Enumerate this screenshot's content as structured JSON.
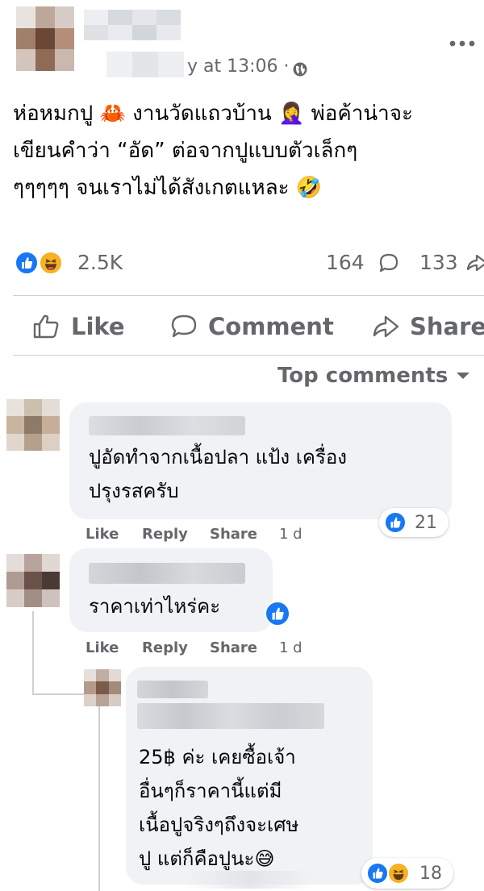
{
  "post": {
    "timestamp": "y at 13:06 ·",
    "more_icon": "more-dots-icon",
    "body_lines": [
      "ห่อหมกปู 🦀 งานวัดแถวบ้าน 🤦‍♀️ พ่อค้าน่าจะ",
      "เขียนคำว่า “อัด” ต่อจากปูแบบตัวเล็กๆ",
      "ๆๆๆๆๆ จนเราไม่ได้สังเกตแหละ 🤣"
    ]
  },
  "stats": {
    "reactions_count": "2.5K",
    "comments_count": "164",
    "shares_count": "133"
  },
  "actions": {
    "like": "Like",
    "comment": "Comment",
    "share": "Share"
  },
  "sort": {
    "label": "Top comments"
  },
  "comments": [
    {
      "text_lines": [
        "ปูอัดทำจากเนื้อปลา แป้ง เครื่อง",
        "ปรุงรสครับ"
      ],
      "reactions": "21",
      "like": "Like",
      "reply": "Reply",
      "share": "Share",
      "age": "1 d"
    },
    {
      "text_lines": [
        "ราคาเท่าไหร่คะ"
      ],
      "like": "Like",
      "reply": "Reply",
      "share": "Share",
      "age": "1 d"
    },
    {
      "text_lines": [
        "25฿ ค่ะ เคยซื้อเจ้า",
        "อื่นๆก็ราคานี้แต่มี",
        "เนื้อปูจริงๆถึงจะเศษ",
        "ปู แต่ก็คือปูนะ😅"
      ],
      "reactions": "18"
    }
  ],
  "colors": {
    "like_blue": "#1877f2",
    "haha_yellow": "#f7b125",
    "muted": "#65676b",
    "bubble": "#f0f2f5"
  }
}
